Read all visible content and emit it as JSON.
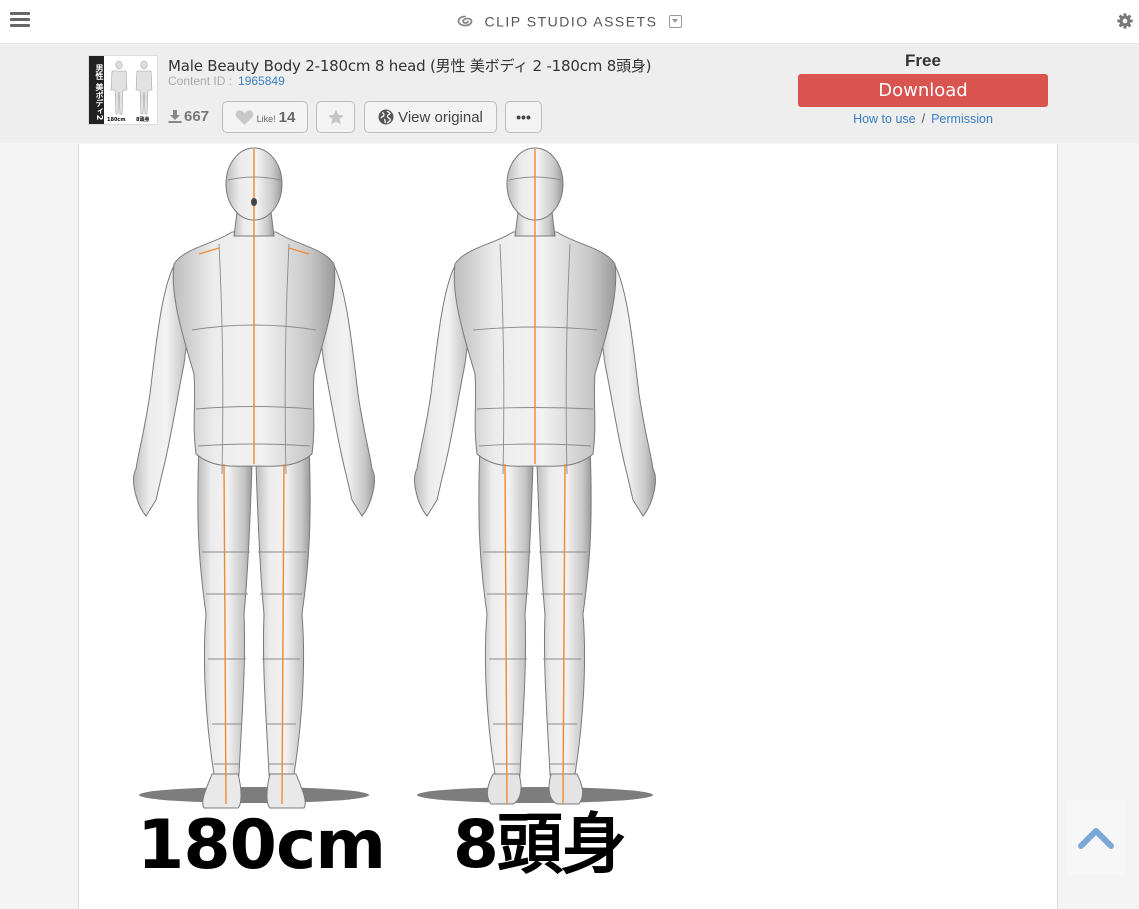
{
  "topbar": {
    "brand": "CLIP STUDIO ASSETS",
    "icons": {
      "menu": "hamburger-menu-icon",
      "logo": "clip-studio-logo-icon",
      "dropdown": "dropdown-icon",
      "settings": "gear-icon"
    }
  },
  "asset": {
    "title": "Male Beauty Body 2-180cm 8 head (男性 美ボディ 2 -180cm 8頭身)",
    "content_id_label": "Content ID :",
    "content_id": "1965849",
    "thumbnail": {
      "side_label": "男性 美ボディ2",
      "caption_left": "180cm",
      "caption_right": "8頭身"
    },
    "download_count": "667",
    "like_label": "Like!",
    "like_count": "14",
    "view_original_label": "View original",
    "more_label": "•••",
    "price": "Free",
    "download_label": "Download",
    "how_to_use_label": "How to use",
    "separator": "/",
    "permission_label": "Permission"
  },
  "preview": {
    "caption_left": "180cm",
    "caption_right": "8頭身",
    "figures": [
      "front-view",
      "back-view"
    ]
  },
  "colors": {
    "download_button": "#d9534f",
    "link": "#3a7fc1",
    "center_line": "#f08a30",
    "scroll_top_arrow": "#7aa7d6"
  }
}
